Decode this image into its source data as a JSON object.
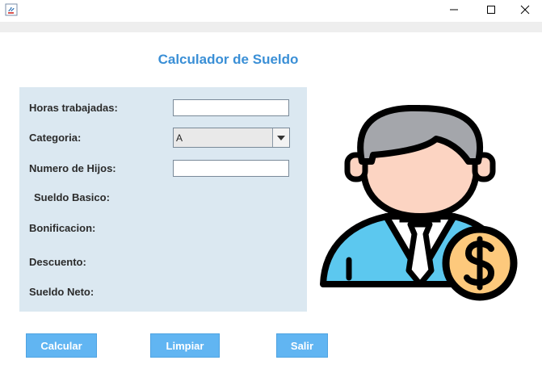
{
  "window": {
    "app_icon": "java-cup-icon",
    "controls": [
      "minimize",
      "maximize",
      "close"
    ]
  },
  "form": {
    "title": "Calculador de Sueldo",
    "labels": {
      "hours": "Horas trabajadas:",
      "category": "Categoria:",
      "children": "Numero de Hijos:",
      "basic_salary": "Sueldo Basico:",
      "bonus": "Bonificacion:",
      "discount": "Descuento:",
      "net_salary": "Sueldo Neto:"
    },
    "fields": {
      "hours_value": "",
      "category_selected": "A",
      "children_value": ""
    }
  },
  "buttons": {
    "calculate": "Calcular",
    "clear": "Limpiar",
    "exit": "Salir"
  },
  "illustration": {
    "icon": "employee-salary-icon",
    "colors": {
      "hair": "#a4a6ab",
      "skin": "#fcd4c2",
      "shirt": "#5cc8ef",
      "coin": "#fdc97c",
      "outline": "#000000"
    }
  },
  "colors": {
    "title": "#3a8fd6",
    "panel": "#dbe8f1",
    "button": "#61b5f2"
  }
}
